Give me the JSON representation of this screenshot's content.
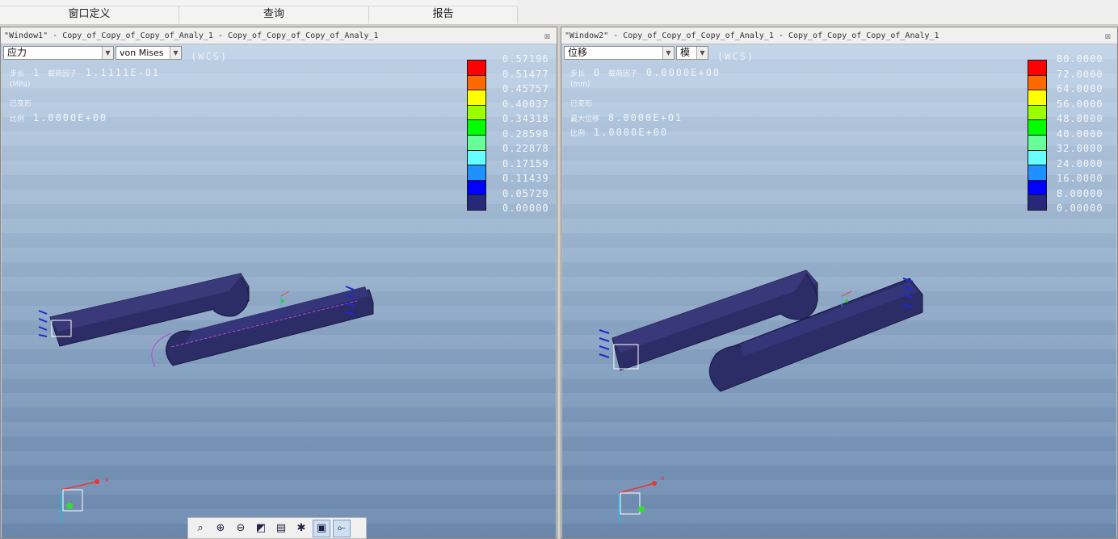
{
  "ribbon": {
    "groups": [
      "窗口定义",
      "查询",
      "报告"
    ]
  },
  "window1": {
    "title": "\"Window1\" - Copy_of_Copy_of_Copy_of_Analy_1 - Copy_of_Copy_of_Copy_of_Analy_1",
    "close": "☒",
    "quantity": "应力",
    "component": "von Mises",
    "wcs": "(WCS)",
    "info": {
      "step_label": "步长",
      "step_value": "1",
      "factor_label": "载荷因子",
      "factor_value": "1.1111E-01",
      "unit": "(MPa)",
      "deformed": "已变形",
      "scale_label": "比例",
      "scale_value": "1.0000E+00"
    },
    "legend_values": [
      "0.57196",
      "0.51477",
      "0.45757",
      "0.40037",
      "0.34318",
      "0.28598",
      "0.22878",
      "0.17159",
      "0.11439",
      "0.05720",
      "0.00000"
    ]
  },
  "window2": {
    "title": "\"Window2\" - Copy_of_Copy_of_Copy_of_Analy_1 - Copy_of_Copy_of_Copy_of_Analy_1",
    "close": "☒",
    "quantity": "位移",
    "component": "模",
    "wcs": "(WCS)",
    "info": {
      "step_label": "步长",
      "step_value": "0",
      "factor_label": "载荷因子",
      "factor_value": "0.0000E+00",
      "unit": "(mm)",
      "deformed": "已变形",
      "max_label": "最大位移",
      "max_value": "8.0000E+01",
      "scale_label": "比例",
      "scale_value": "1.0000E+00"
    },
    "legend_values": [
      "80.0000",
      "72.0000",
      "64.0000",
      "56.0000",
      "48.0000",
      "40.0000",
      "32.0000",
      "24.0000",
      "16.0000",
      "8.00000",
      "0.00000"
    ]
  },
  "legend_colors": [
    "#ff0000",
    "#ff6a00",
    "#ffff00",
    "#9bff00",
    "#00ff00",
    "#66ff99",
    "#66ffff",
    "#1e90ff",
    "#0000ff",
    "#28287a"
  ],
  "toolbar": {
    "icons": [
      "zoom-fit-icon",
      "zoom-in-icon",
      "zoom-out-icon",
      "reorient-icon",
      "saved-views-icon",
      "spin-center-icon",
      "display-style-icon",
      "datum-display-icon"
    ]
  }
}
